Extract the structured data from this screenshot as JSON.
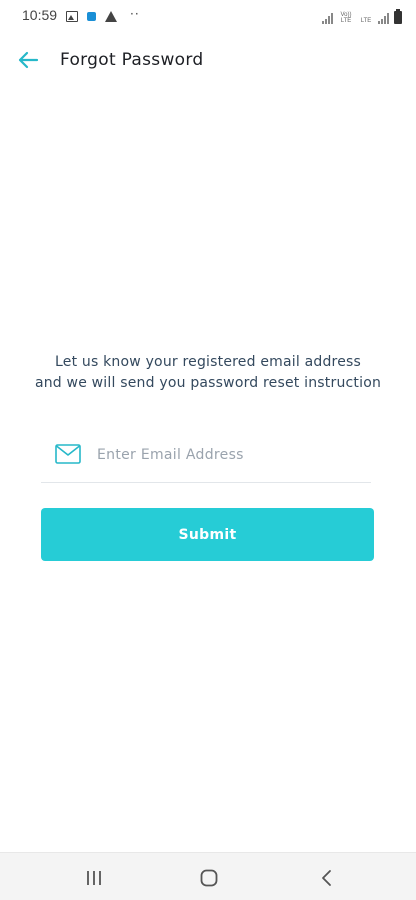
{
  "status_bar": {
    "time": "10:59",
    "icons": [
      "image-icon",
      "bag-icon",
      "warning-icon",
      "more-dots-icon",
      "signal-icon",
      "lte-icon",
      "battery-icon"
    ],
    "more_dots": "··",
    "volte_label": "Vo)) LTE",
    "lte_label": "LTE"
  },
  "app_bar": {
    "title": "Forgot Password",
    "back_icon": "arrow-left-icon"
  },
  "main": {
    "instruction_line1": "Let us know your registered email address",
    "instruction_line2": "and we will send you password reset instruction",
    "email_field": {
      "placeholder": "Enter Email Address",
      "value": "",
      "icon": "mail-icon"
    },
    "submit_label": "Submit"
  },
  "nav_bar": {
    "items": [
      "recent-apps-icon",
      "home-icon",
      "back-icon"
    ]
  },
  "colors": {
    "accent": "#26ccd6",
    "back_arrow": "#26b8c9",
    "text": "#34495e",
    "nav_bg": "#f4f4f4"
  }
}
